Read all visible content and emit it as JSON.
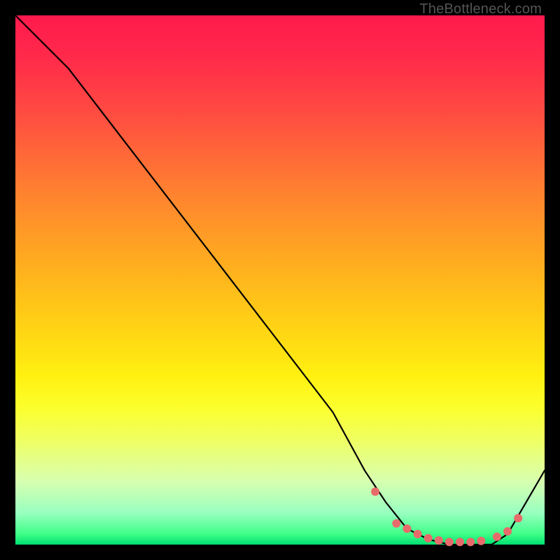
{
  "attribution": "TheBottleneck.com",
  "chart_data": {
    "type": "line",
    "title": "",
    "xlabel": "",
    "ylabel": "",
    "xlim": [
      0,
      100
    ],
    "ylim": [
      0,
      100
    ],
    "series": [
      {
        "name": "curve",
        "x": [
          0,
          4,
          10,
          20,
          30,
          40,
          50,
          60,
          66,
          70,
          74,
          78,
          82,
          86,
          90,
          93,
          100
        ],
        "y": [
          100,
          96,
          90,
          77,
          64,
          51,
          38,
          25,
          14,
          8,
          3,
          1,
          0,
          0,
          0,
          2,
          14
        ]
      }
    ],
    "markers": {
      "name": "highlight-points",
      "color": "#e86b6b",
      "x": [
        68,
        72,
        74,
        76,
        78,
        80,
        82,
        84,
        86,
        88,
        91,
        93,
        95
      ],
      "y": [
        10,
        4,
        3,
        2,
        1.2,
        0.8,
        0.5,
        0.5,
        0.5,
        0.7,
        1.5,
        2.5,
        5
      ]
    }
  }
}
